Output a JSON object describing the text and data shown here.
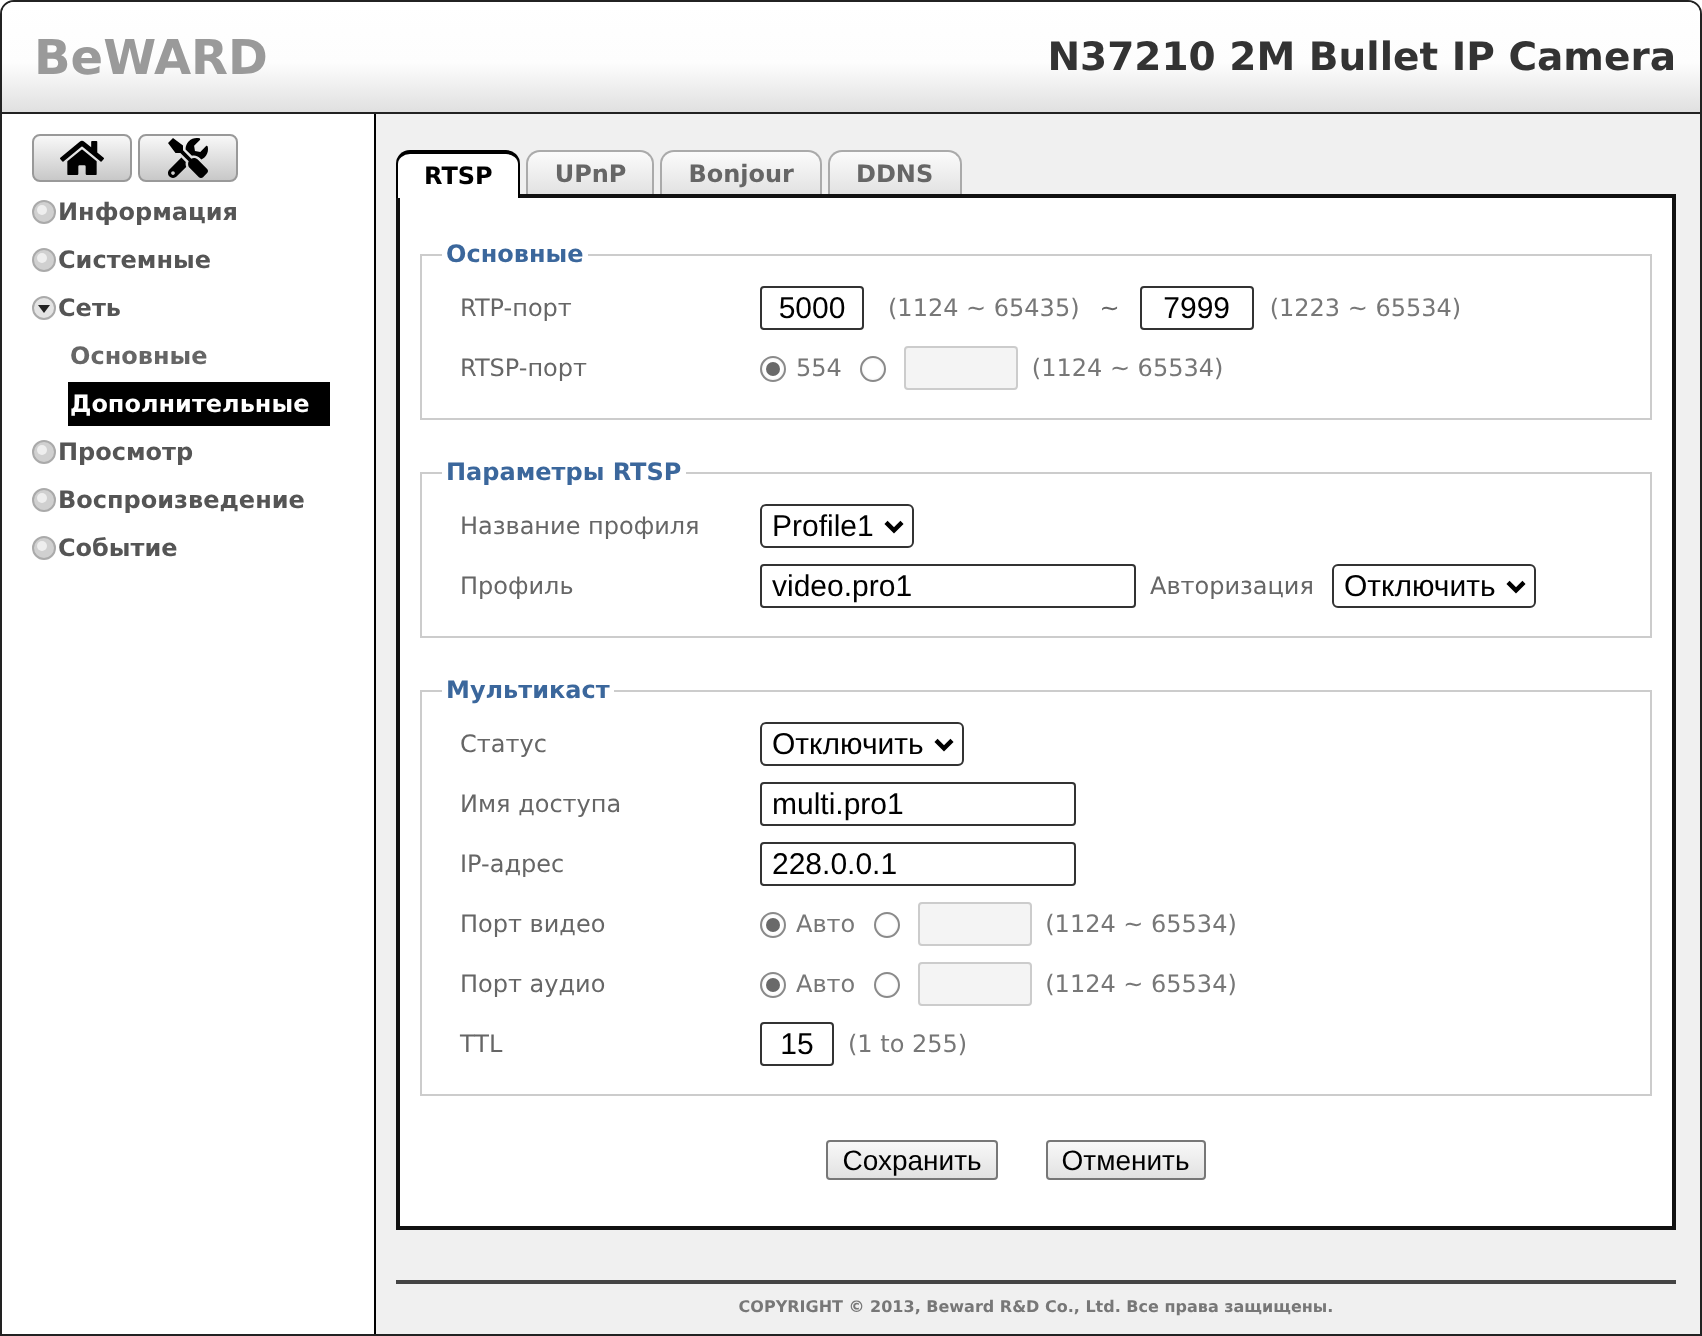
{
  "header": {
    "logo": "BeWARD",
    "title": "N37210 2M Bullet IP Camera"
  },
  "sidebar": {
    "menu": [
      {
        "label": "Информация",
        "expanded": false
      },
      {
        "label": "Системные",
        "expanded": false
      },
      {
        "label": "Сеть",
        "expanded": true,
        "children": [
          {
            "label": "Основные",
            "selected": false
          },
          {
            "label": "Дополнительные",
            "selected": true
          }
        ]
      },
      {
        "label": "Просмотр",
        "expanded": false
      },
      {
        "label": "Воспроизведение",
        "expanded": false
      },
      {
        "label": "Событие",
        "expanded": false
      }
    ]
  },
  "tabs": [
    {
      "label": "RTSP",
      "selected": true
    },
    {
      "label": "UPnP",
      "selected": false
    },
    {
      "label": "Bonjour",
      "selected": false
    },
    {
      "label": "DDNS",
      "selected": false
    }
  ],
  "sections": [
    {
      "title": "Основные",
      "rows": [
        {
          "kind": "port_range",
          "label": "RTP-порт",
          "start": "5000",
          "start_hint": "(1124 ~ 65435)",
          "separator": "~",
          "end": "7999",
          "end_hint": "(1223 ~ 65534)"
        },
        {
          "kind": "port_choice",
          "label": "RTSP-порт",
          "default_option": {
            "label": "554",
            "selected": true
          },
          "custom_option": {
            "selected": false,
            "disabled": true
          },
          "hint": "(1124 ~ 65534)"
        }
      ]
    },
    {
      "title": "Параметры RTSP",
      "rows": [
        {
          "kind": "select",
          "label": "Название профиля",
          "value": "Profile1"
        },
        {
          "kind": "text_with_select",
          "label": "Профиль",
          "value": "video.pro1",
          "extra_label": "Авторизация",
          "extra_value": "Отключить"
        }
      ]
    },
    {
      "title": "Мультикаст",
      "rows": [
        {
          "kind": "select",
          "label": "Статус",
          "value": "Отключить"
        },
        {
          "kind": "text",
          "label": "Имя доступа",
          "value": "multi.pro1"
        },
        {
          "kind": "text",
          "label": "IP-адрес",
          "value": "228.0.0.1"
        },
        {
          "kind": "port_choice",
          "label": "Порт видео",
          "default_option": {
            "label": "Авто",
            "selected": true
          },
          "custom_option": {
            "selected": false,
            "disabled": true
          },
          "hint": "(1124 ~ 65534)"
        },
        {
          "kind": "port_choice",
          "label": "Порт аудио",
          "default_option": {
            "label": "Авто",
            "selected": true
          },
          "custom_option": {
            "selected": false,
            "disabled": true
          },
          "hint": "(1124 ~ 65534)"
        },
        {
          "kind": "number",
          "label": "TTL",
          "value": "15",
          "hint": "(1 to 255)"
        }
      ]
    }
  ],
  "buttons": [
    {
      "label": "Сохранить"
    },
    {
      "label": "Отменить"
    }
  ],
  "footer": {
    "copyright": "COPYRIGHT © 2013, Beward R&D Co., Ltd. Все права защищены."
  }
}
